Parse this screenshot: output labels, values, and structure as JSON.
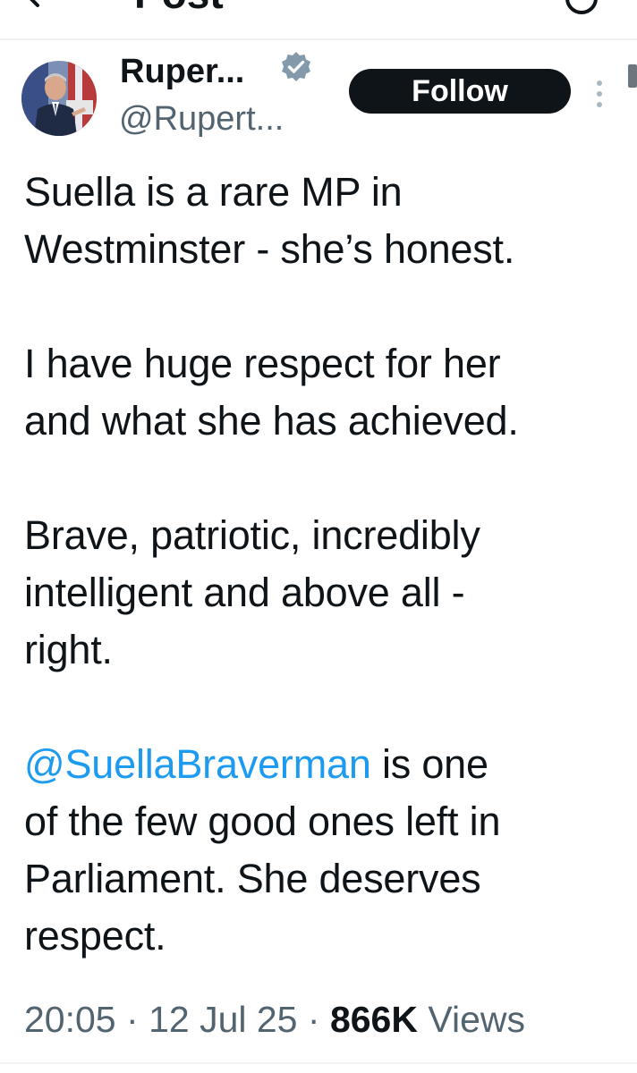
{
  "header": {
    "title": "Post",
    "back_icon": "arrow-left-icon",
    "right_icon": "reply-settings-icon"
  },
  "author": {
    "display_name": "Ruper...",
    "handle": "@Rupert...",
    "verified_icon": "verified-badge-icon",
    "follow_label": "Follow",
    "more_icon": "more-options-icon"
  },
  "tweet": {
    "paragraphs": [
      [
        "Suella is a rare MP in",
        "Westminster - she’s honest."
      ],
      [
        "I have huge respect for her",
        "and what she has achieved."
      ],
      [
        "Brave, patriotic, incredibly",
        "intelligent and above all -",
        "right."
      ]
    ],
    "mention": "@SuellaBraverman",
    "mention_rest_line1": " is one",
    "final_lines": [
      "of the few good ones left in",
      "Parliament. She deserves",
      "respect."
    ]
  },
  "meta": {
    "time": "20:05",
    "separator": "·",
    "date": "12 Jul 25",
    "views_count": "866K",
    "views_label": "Views"
  },
  "colors": {
    "text": "#0f1419",
    "secondary": "#536471",
    "link": "#1d9bf0",
    "verified": "#829aab",
    "follow_bg": "#0f1419",
    "divider": "#eff3f4"
  }
}
